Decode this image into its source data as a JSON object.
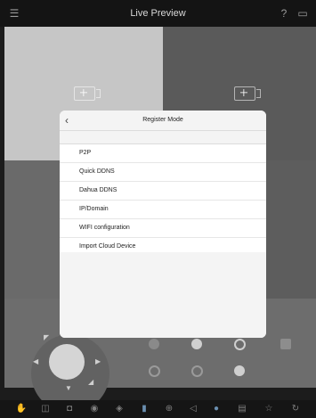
{
  "top_bar": {
    "title": "Live Preview",
    "menu_icon": "menu-icon",
    "help_icon": "help-icon",
    "cast_icon": "cast-icon"
  },
  "modal": {
    "title": "Register Mode",
    "back_icon": "back-chevron-icon",
    "items": [
      "P2P",
      "Quick DDNS",
      "Dahua DDNS",
      "IP/Domain",
      "WIFI configuration",
      "Import Cloud Device"
    ]
  },
  "ptz": {
    "joystick": "ptz-joystick"
  },
  "bottom_bar": {
    "icons": [
      "touch-icon",
      "snapshot-icon",
      "record-icon",
      "replay-icon",
      "ptz-icon",
      "stream-icon",
      "add-icon",
      "audio-icon",
      "talk-icon",
      "quality-icon",
      "favorite-icon",
      "rotate-icon"
    ]
  },
  "colors": {
    "modal_bg": "#f4f4f4",
    "list_bg": "#ffffff",
    "background": "#1c1c1c"
  }
}
